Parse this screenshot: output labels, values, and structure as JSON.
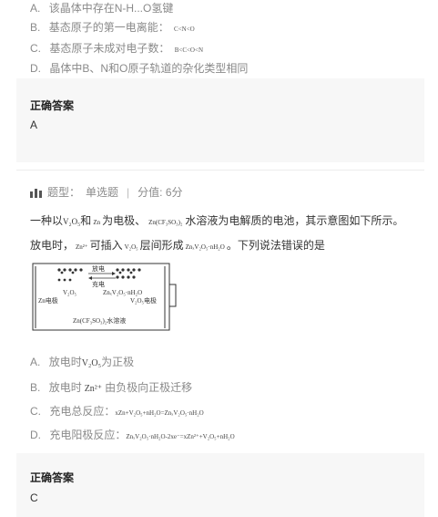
{
  "prev_question": {
    "options": [
      {
        "letter": "A.",
        "text": "该晶体中存在N-H...O氢键"
      },
      {
        "letter": "B.",
        "text": "基态原子的第一电离能：",
        "formula": "C<N<O"
      },
      {
        "letter": "C.",
        "text": "基态原子未成对电子数：",
        "formula": "B<C<O<N"
      },
      {
        "letter": "D.",
        "text": "晶体中B、N和O原子轨道的杂化类型相同"
      }
    ],
    "answer_title": "正确答案",
    "answer": "A"
  },
  "question": {
    "type_label": "题型：",
    "type_value": "单选题",
    "score_label": "分值: 6分",
    "stem_1_a": "一种以",
    "stem_1_b": "V₂O₅",
    "stem_1_c": "和",
    "stem_1_d": "Zn",
    "stem_1_e": "为电极、",
    "stem_1_f": "Zn(CF₃SO₃)₂",
    "stem_1_g": "水溶液为电解质的电池，其示意图如下所示。",
    "stem_2_a": "放电时，",
    "stem_2_b": "Zn²⁺",
    "stem_2_c": "可插入",
    "stem_2_d": "V₂O₅",
    "stem_2_e": "层间形成",
    "stem_2_f": "ZnₓV₂O₅·nH₂O",
    "stem_2_g": "。下列说法错误的是",
    "diagram": {
      "discharge": "放电",
      "charge": "充电",
      "left_top": "V₂O₅",
      "middle": "ZnₓV₂O₅·nH₂O",
      "left_electrode": "Zn电极",
      "right_electrode": "V₂O₅电极",
      "electrolyte": "Zn(CF₃SO₃)₂水溶液"
    },
    "options": [
      {
        "letter": "A.",
        "text_a": "放电时",
        "formula": "V₂O₅",
        "text_b": "为正极"
      },
      {
        "letter": "B.",
        "text_a": "放电时",
        "formula": "Zn²⁺",
        "text_b": "由负极向正极迁移"
      },
      {
        "letter": "C.",
        "text_a": "充电总反应：",
        "formula": "xZn+V₂O₅+nH₂O=ZnₓV₂O₅·nH₂O",
        "text_b": ""
      },
      {
        "letter": "D.",
        "text_a": "充电阳极反应：",
        "formula": "ZnₓV₂O₅·nH₂O-2xe⁻=xZn²⁺+V₂O₅+nH₂O",
        "text_b": ""
      }
    ],
    "answer_title": "正确答案",
    "answer": "C"
  }
}
